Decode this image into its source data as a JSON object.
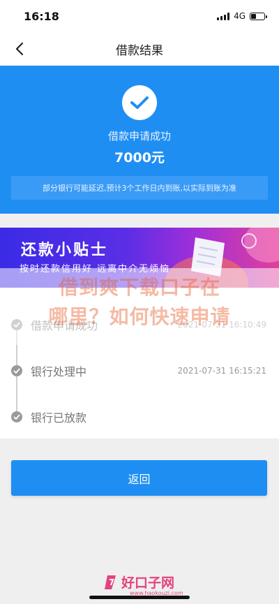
{
  "status_bar": {
    "time": "16:18",
    "network": "4G"
  },
  "nav": {
    "title": "借款结果"
  },
  "result": {
    "status": "借款申请成功",
    "amount": "7000元",
    "note": "部分银行可能延迟,预计3个工作日内到账,以实际到账为准"
  },
  "banner": {
    "title": "还款小贴士",
    "subtitle": "按时还款信用好 远离中介无烦恼"
  },
  "watermark": {
    "line1": "借到爽下载口子在",
    "line2": "哪里？如何快速申请"
  },
  "steps": [
    {
      "label": "借款申请成功",
      "time": "2021-07-31 16:10:49"
    },
    {
      "label": "银行处理中",
      "time": "2021-07-31 16:15:21"
    },
    {
      "label": "银行已放款",
      "time": ""
    }
  ],
  "actions": {
    "return_label": "返回"
  },
  "footer": {
    "logo_text": "好口子网",
    "url": "www.haokouzi.com"
  },
  "colors": {
    "primary": "#1f8ef3",
    "logo": "#e4427d"
  }
}
